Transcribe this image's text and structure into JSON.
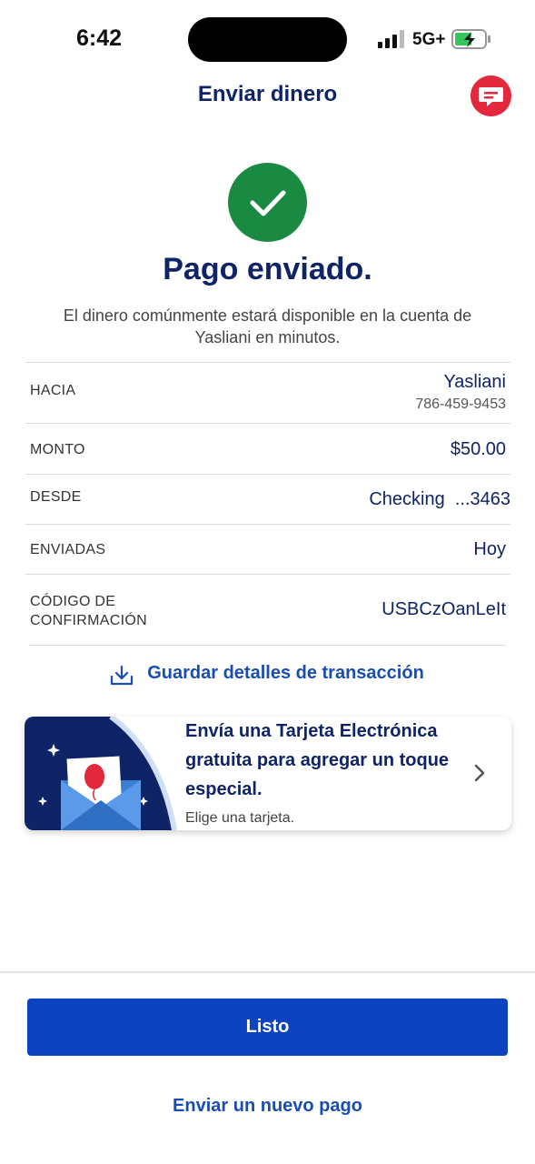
{
  "status_bar": {
    "time": "6:42",
    "network": "5G+",
    "signal_icon": "signal-bars-icon",
    "battery_icon": "battery-charging-icon"
  },
  "header": {
    "title": "Enviar dinero",
    "chat_icon": "chat-icon"
  },
  "success": {
    "icon": "check-circle-icon",
    "headline": "Pago enviado.",
    "message": "El dinero comúnmente estará disponible en la cuenta de Yasliani en minutos."
  },
  "details": {
    "to_label": "HACIA",
    "to_name": "Yasliani",
    "to_phone": "786-459-9453",
    "amount_label": "MONTO",
    "amount_value": "$50.00",
    "from_label": "DESDE",
    "from_value": "Checking  ...3463",
    "sent_label": "ENVIADAS",
    "sent_value": "Hoy",
    "code_label_line1": "CÓDIGO DE",
    "code_label_line2": "CONFIRMACIÓN",
    "code_value": "USBCzOanLeIt"
  },
  "save_link": {
    "label": "Guardar detalles de transacción",
    "icon": "download-icon"
  },
  "promo_card": {
    "title": "Envía una Tarjeta Electrónica gratuita para agregar un toque especial.",
    "subtitle": "Elige una tarjeta.",
    "art_icon": "envelope-balloon-icon",
    "chevron_icon": "chevron-right-icon"
  },
  "footer": {
    "done_label": "Listo",
    "new_payment_label": "Enviar un nuevo pago"
  },
  "colors": {
    "navy": "#0f2466",
    "primary": "#0d43c1",
    "success": "#1a8a42",
    "red": "#e2283a",
    "link": "#1a4db0"
  }
}
